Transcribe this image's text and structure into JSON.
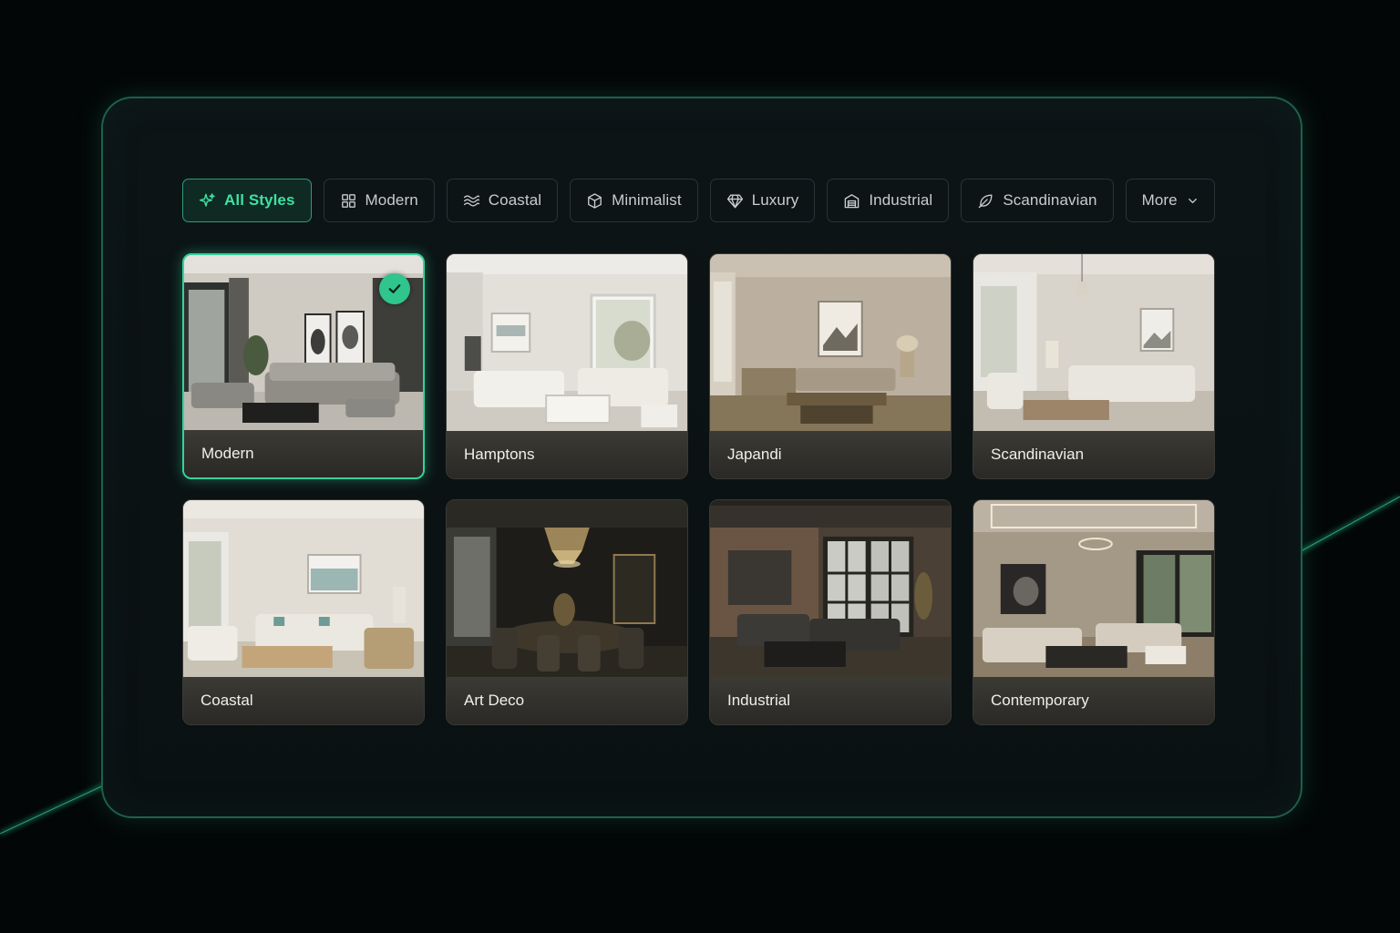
{
  "filters": [
    {
      "label": "All Styles",
      "icon": "sparkle-icon",
      "active": true
    },
    {
      "label": "Modern",
      "icon": "grid-icon",
      "active": false
    },
    {
      "label": "Coastal",
      "icon": "waves-icon",
      "active": false
    },
    {
      "label": "Minimalist",
      "icon": "cube-icon",
      "active": false
    },
    {
      "label": "Luxury",
      "icon": "diamond-icon",
      "active": false
    },
    {
      "label": "Industrial",
      "icon": "factory-icon",
      "active": false
    },
    {
      "label": "Scandinavian",
      "icon": "leaf-icon",
      "active": false
    },
    {
      "label": "More",
      "icon": "chevron-down-icon",
      "active": false
    }
  ],
  "styles": [
    {
      "name": "Modern",
      "selected": true
    },
    {
      "name": "Hamptons",
      "selected": false
    },
    {
      "name": "Japandi",
      "selected": false
    },
    {
      "name": "Scandinavian",
      "selected": false
    },
    {
      "name": "Coastal",
      "selected": false
    },
    {
      "name": "Art Deco",
      "selected": false
    },
    {
      "name": "Industrial",
      "selected": false
    },
    {
      "name": "Contemporary",
      "selected": false
    }
  ],
  "colors": {
    "accent": "#35d39a",
    "active_chip_text": "#3fe0a2",
    "panel_border": "#2ea078",
    "background": "#030607"
  }
}
